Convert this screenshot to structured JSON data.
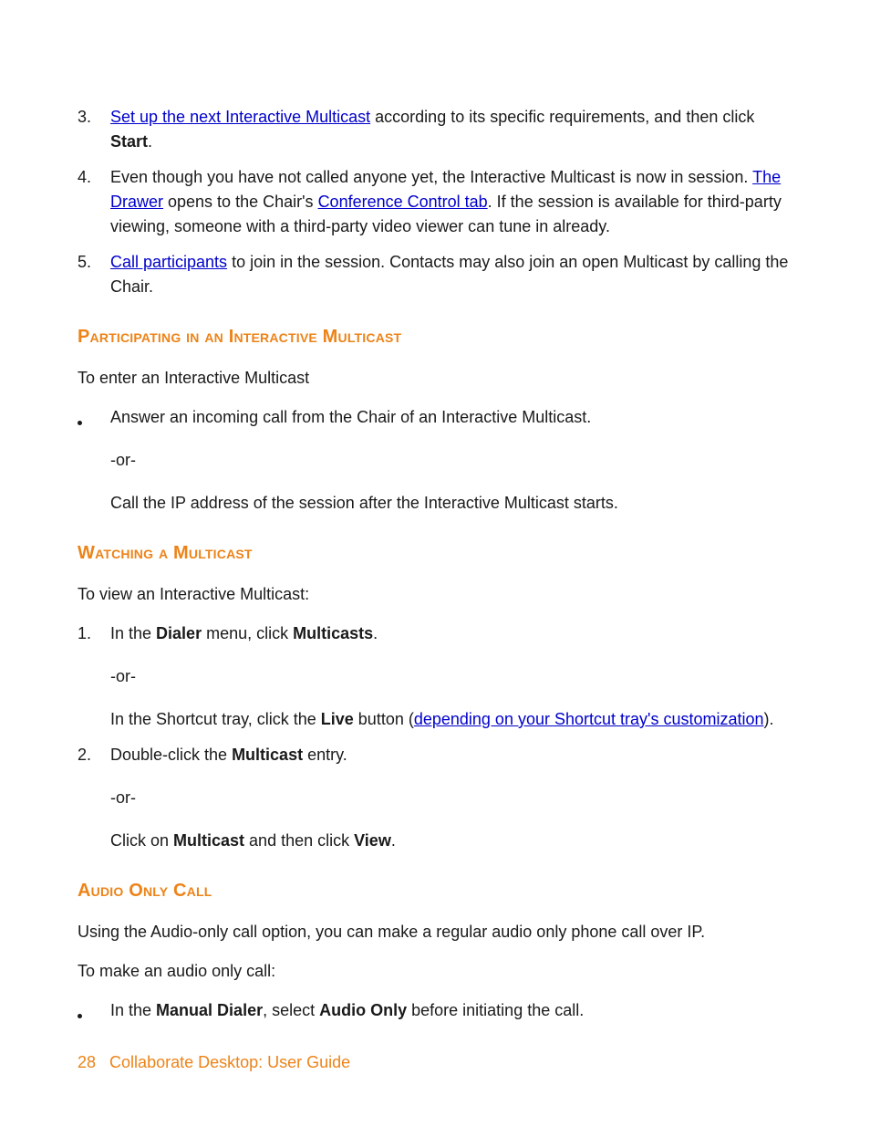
{
  "steps_top": {
    "items": [
      {
        "marker": "3.",
        "link1": "Set up the next Interactive Multicast",
        "text1": " according to its specific requirements, and then click ",
        "bold1": "Start",
        "text2": "."
      },
      {
        "marker": "4.",
        "text1": "Even though you have not called anyone yet, the Interactive Multicast is now in session. ",
        "link1": "The Drawer",
        "text2": " opens to the Chair's ",
        "link2": "Conference Control tab",
        "text3": ". If the session is available for third-party viewing, someone with a third-party video viewer can tune in already."
      },
      {
        "marker": "5.",
        "link1": "Call participants",
        "text1": " to join in the session. Contacts may also join an open Multicast by calling the Chair."
      }
    ]
  },
  "participating": {
    "heading": "Participating in an Interactive Multicast",
    "intro": "To enter an Interactive Multicast",
    "bullet": {
      "text": "Answer an incoming call from the Chair of an Interactive Multicast."
    },
    "or": "-or-",
    "alt": "Call the IP address of the session after the Interactive Multicast starts."
  },
  "watching": {
    "heading": "Watching a Multicast",
    "intro": "To view an Interactive Multicast:",
    "steps": [
      {
        "marker": "1.",
        "text1": "In the ",
        "bold1": "Dialer",
        "text2": " menu, click ",
        "bold2": "Multicasts",
        "text3": "."
      },
      {
        "marker": "2.",
        "text1": "Double-click the ",
        "bold1": "Multicast",
        "text2": " entry."
      }
    ],
    "or": "-or-",
    "step1_alt": {
      "text1": "In the Shortcut tray, click the ",
      "bold1": "Live",
      "text2": " button (",
      "link1": "depending on your Shortcut tray's customization",
      "text3": ")."
    },
    "step2_alt": {
      "text1": "Click on ",
      "bold1": "Multicast",
      "text2": " and then click ",
      "bold2": "View",
      "text3": "."
    }
  },
  "audio_only": {
    "heading": "Audio Only Call",
    "intro": "Using the Audio-only call option, you can make a regular audio only phone call over IP.",
    "sub": "To make an audio only call:",
    "bullet": {
      "text1": "In the ",
      "bold1": "Manual Dialer",
      "text2": ", select ",
      "bold2": "Audio Only",
      "text3": " before initiating the call."
    }
  },
  "footer": {
    "page_num": "28",
    "title": "Collaborate Desktop: User Guide"
  }
}
